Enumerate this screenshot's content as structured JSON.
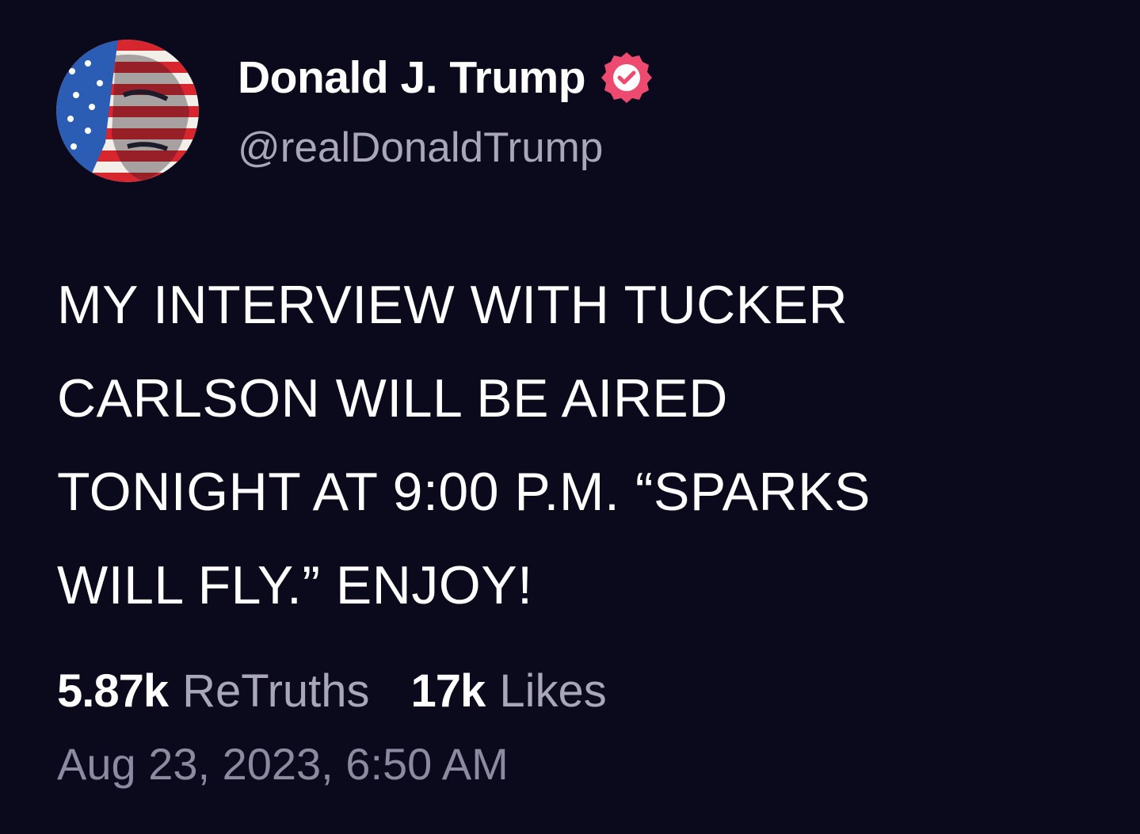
{
  "author": {
    "display_name": "Donald J. Trump",
    "handle": "@realDonaldTrump",
    "avatar_icon": "profile-avatar-flag-portrait",
    "verified_icon": "verified-badge-icon",
    "verified_color": "#ec4a6e"
  },
  "post": {
    "text_lines": [
      "MY INTERVIEW WITH TUCKER",
      "CARLSON WILL BE AIRED",
      "TONIGHT AT 9:00 P.M. “SPARKS",
      "WILL FLY.” ENJOY!"
    ]
  },
  "stats": {
    "retruths_count": "5.87k",
    "retruths_label": "ReTruths",
    "likes_count": "17k",
    "likes_label": "Likes"
  },
  "timestamp": "Aug 23, 2023, 6:50 AM",
  "colors": {
    "background": "#0b0a1d",
    "text_primary": "#ffffff",
    "text_secondary": "#a8a6b8"
  }
}
